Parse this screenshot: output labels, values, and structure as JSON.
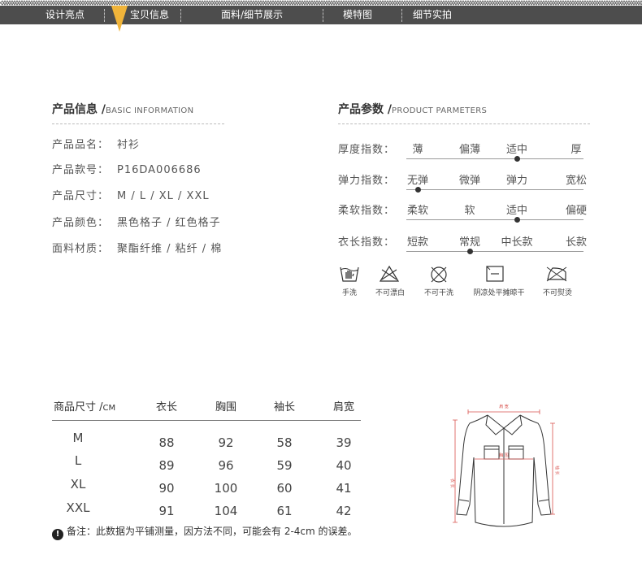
{
  "nav": {
    "items": [
      "设计亮点",
      "宝贝信息",
      "面料/细节展示",
      "模特图",
      "细节实拍"
    ],
    "active": "宝贝信息",
    "bar_color": "#4d4d4d",
    "pointer_color": "#f0b43a"
  },
  "basic": {
    "title": "产品信息 /",
    "title_en": "BASIC INFORMATION",
    "rows": [
      {
        "label": "产品品名：",
        "value": "衬衫"
      },
      {
        "label": "产品款号：",
        "value": "P16DA006686"
      },
      {
        "label": "产品尺寸：",
        "value": "M / L / XL / XXL"
      },
      {
        "label": "产品颜色：",
        "value": "黑色格子 / 红色格子"
      },
      {
        "label": "面料材质：",
        "value": "聚酯纤维 / 粘纤 / 棉"
      }
    ]
  },
  "params": {
    "title": "产品参数 /",
    "title_en": "PRODUCT PARMETERS",
    "rows": [
      {
        "label": "厚度指数：",
        "options": [
          "薄",
          "偏薄",
          "适中",
          "厚"
        ],
        "selected_index": 2
      },
      {
        "label": "弹力指数：",
        "options": [
          "无弹",
          "微弹",
          "弹力",
          "宽松"
        ],
        "selected_index": 0
      },
      {
        "label": "柔软指数：",
        "options": [
          "柔软",
          "软",
          "适中",
          "偏硬"
        ],
        "selected_index": 2
      },
      {
        "label": "衣长指数：",
        "options": [
          "短款",
          "常规",
          "中长款",
          "长款"
        ],
        "selected_index": 1
      }
    ]
  },
  "care": [
    {
      "label": "手洗",
      "icon": "hand-wash-icon"
    },
    {
      "label": "不可漂白",
      "icon": "no-bleach-icon"
    },
    {
      "label": "不可干洗",
      "icon": "no-dry-clean-icon"
    },
    {
      "label": "阴凉处平摊晾干",
      "icon": "dry-flat-shade-icon"
    },
    {
      "label": "不可熨烫",
      "icon": "no-iron-icon"
    }
  ],
  "size_table": {
    "header_label": "商品尺寸 /",
    "header_unit": "CM",
    "columns": [
      "衣长",
      "胸围",
      "袖长",
      "肩宽"
    ],
    "rows": [
      {
        "size": "M",
        "values": [
          "88",
          "92",
          "58",
          "39"
        ]
      },
      {
        "size": "L",
        "values": [
          "89",
          "96",
          "59",
          "40"
        ]
      },
      {
        "size": "XL",
        "values": [
          "90",
          "100",
          "60",
          "41"
        ]
      },
      {
        "size": "XXL",
        "values": [
          "91",
          "104",
          "61",
          "42"
        ]
      }
    ]
  },
  "note": {
    "icon": "!",
    "text": "备注：此数据为平铺测量，因方法不同，可能会有 2-4cm 的误差。"
  },
  "diagram": {
    "shoulder": "肩 宽",
    "chest": "胸 围",
    "length": "衣 长",
    "sleeve": "袖 长",
    "accent_color": "#d9534f"
  }
}
